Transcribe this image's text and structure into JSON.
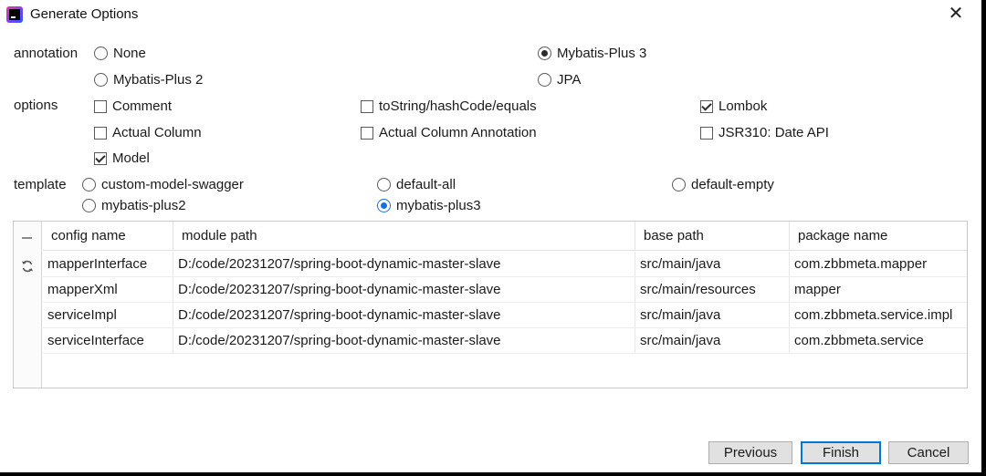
{
  "window": {
    "title": "Generate Options",
    "close_glyph": "✕"
  },
  "annotation": {
    "label": "annotation",
    "options": [
      {
        "label": "None",
        "checked": false
      },
      {
        "label": "Mybatis-Plus 3",
        "checked": true
      },
      {
        "label": "Mybatis-Plus 2",
        "checked": false
      },
      {
        "label": "JPA",
        "checked": false
      }
    ]
  },
  "options": {
    "label": "options",
    "checkboxes": [
      {
        "label": "Comment",
        "checked": false
      },
      {
        "label": "toString/hashCode/equals",
        "checked": false
      },
      {
        "label": "Lombok",
        "checked": true
      },
      {
        "label": "Actual Column",
        "checked": false
      },
      {
        "label": "Actual Column Annotation",
        "checked": false
      },
      {
        "label": "JSR310: Date API",
        "checked": false
      },
      {
        "label": "Model",
        "checked": true
      }
    ]
  },
  "template": {
    "label": "template",
    "options": [
      {
        "label": "custom-model-swagger",
        "checked": false
      },
      {
        "label": "default-all",
        "checked": false
      },
      {
        "label": "default-empty",
        "checked": false
      },
      {
        "label": "mybatis-plus2",
        "checked": false
      },
      {
        "label": "mybatis-plus3",
        "checked": true
      }
    ]
  },
  "table": {
    "columns": [
      "config name",
      "module path",
      "base path",
      "package name"
    ],
    "rows": [
      [
        "mapperInterface",
        "D:/code/20231207/spring-boot-dynamic-master-slave",
        "src/main/java",
        "com.zbbmeta.mapper"
      ],
      [
        "mapperXml",
        "D:/code/20231207/spring-boot-dynamic-master-slave",
        "src/main/resources",
        "mapper"
      ],
      [
        "serviceImpl",
        "D:/code/20231207/spring-boot-dynamic-master-slave",
        "src/main/java",
        "com.zbbmeta.service.impl"
      ],
      [
        "serviceInterface",
        "D:/code/20231207/spring-boot-dynamic-master-slave",
        "src/main/java",
        "com.zbbmeta.service"
      ]
    ],
    "gutter_icons": [
      "minus-icon",
      "refresh-icon"
    ]
  },
  "buttons": {
    "previous": "Previous",
    "finish": "Finish",
    "cancel": "Cancel"
  },
  "colors": {
    "accent": "#0078d7",
    "radio_selected_blue": "#1a6fe0"
  }
}
